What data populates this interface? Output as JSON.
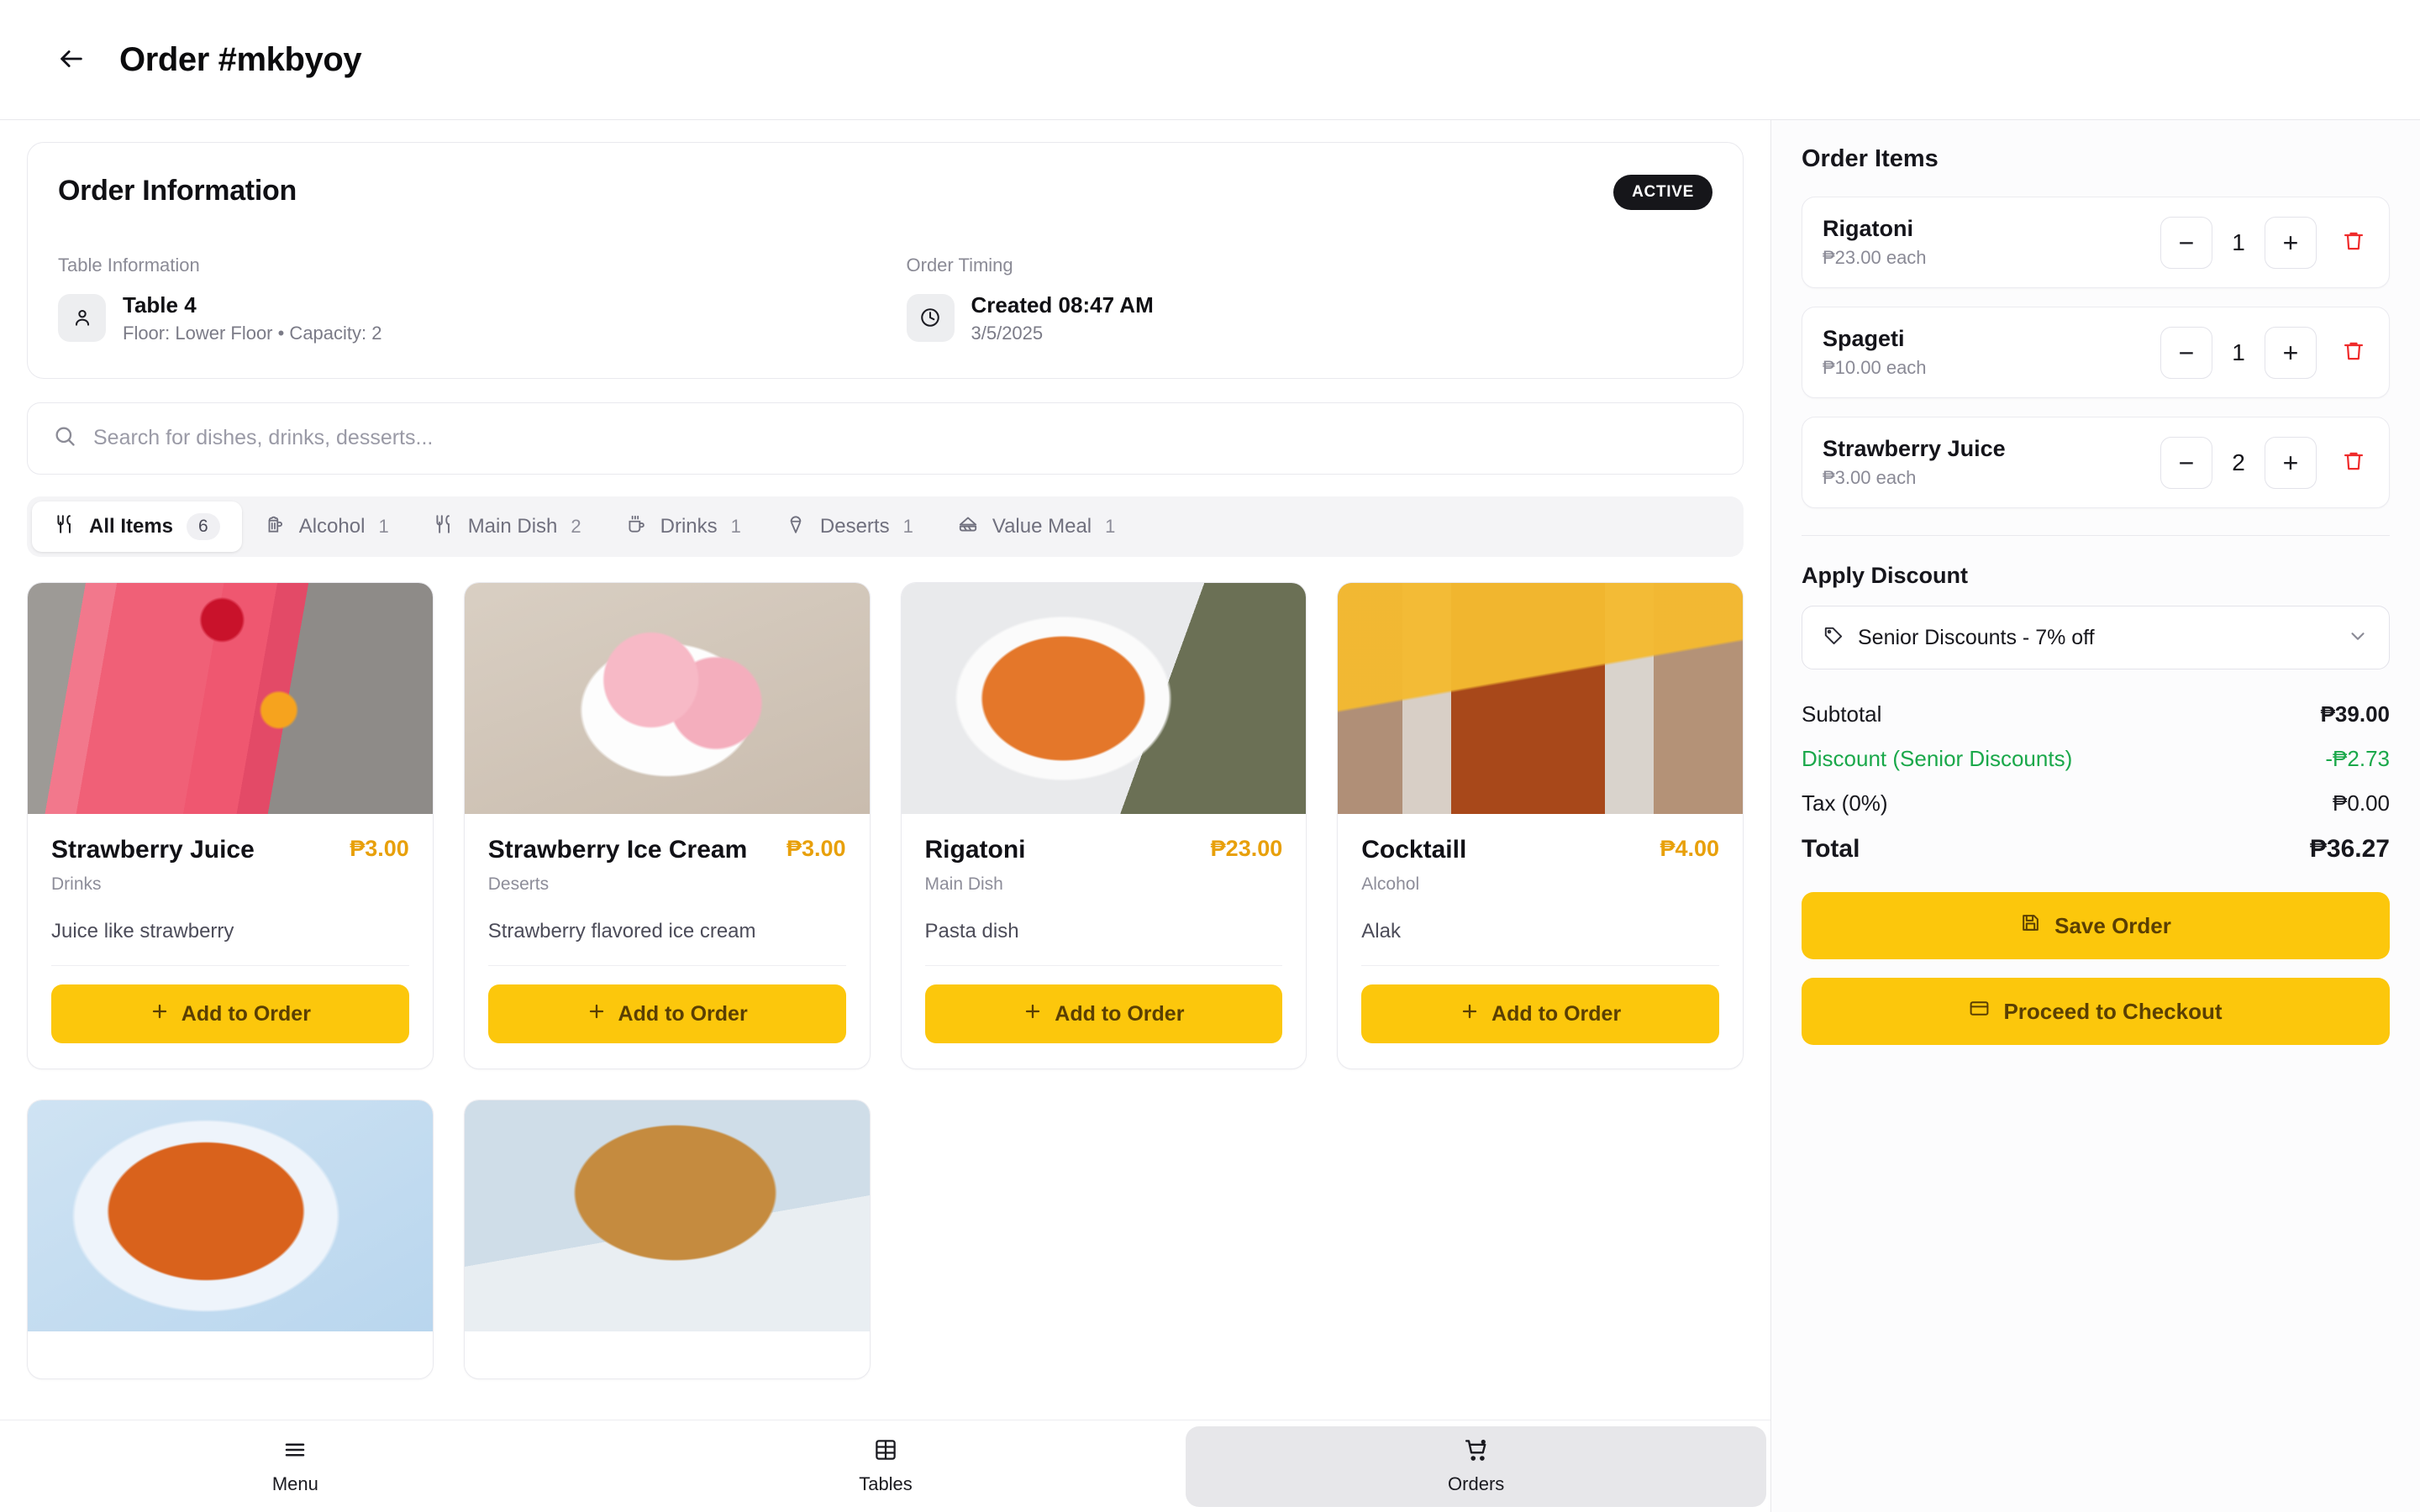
{
  "header": {
    "back_icon": "arrow-left-icon",
    "title": "Order #mkbyoy"
  },
  "order_info": {
    "title": "Order Information",
    "status_badge": "ACTIVE",
    "table_section_label": "Table Information",
    "table_icon": "user-icon",
    "table_name": "Table 4",
    "table_detail": "Floor: Lower Floor  •  Capacity: 2",
    "timing_section_label": "Order Timing",
    "timing_icon": "clock-icon",
    "created_time": "Created 08:47 AM",
    "created_date": "3/5/2025"
  },
  "search": {
    "icon": "search-icon",
    "placeholder": "Search for dishes, drinks, desserts...",
    "value": ""
  },
  "tabs": [
    {
      "label": "All Items",
      "count": "6",
      "icon": "fork-knife-icon",
      "active": true
    },
    {
      "label": "Alcohol",
      "count": "1",
      "icon": "beer-mug-icon",
      "active": false
    },
    {
      "label": "Main Dish",
      "count": "2",
      "icon": "fork-knife-icon",
      "active": false
    },
    {
      "label": "Drinks",
      "count": "1",
      "icon": "coffee-cup-icon",
      "active": false
    },
    {
      "label": "Deserts",
      "count": "1",
      "icon": "ice-cream-cone-icon",
      "active": false
    },
    {
      "label": "Value Meal",
      "count": "1",
      "icon": "sandwich-icon",
      "active": false
    }
  ],
  "menu": {
    "add_button_label": "Add to Order",
    "add_icon": "plus-icon",
    "items": [
      {
        "name": "Strawberry Juice",
        "price": "₱3.00",
        "category": "Drinks",
        "description": "Juice like strawberry",
        "image": "strawberry-juice-photo"
      },
      {
        "name": "Strawberry Ice Cream",
        "price": "₱3.00",
        "category": "Deserts",
        "description": "Strawberry flavored ice cream",
        "image": "strawberry-ice-cream-photo"
      },
      {
        "name": "Rigatoni",
        "price": "₱23.00",
        "category": "Main Dish",
        "description": "Pasta dish",
        "image": "rigatoni-photo"
      },
      {
        "name": "Cocktaill",
        "price": "₱4.00",
        "category": "Alcohol",
        "description": "Alak",
        "image": "cocktail-photo"
      }
    ],
    "partial_row_images": [
      "spaghetti-photo",
      "burger-photo"
    ]
  },
  "order_panel": {
    "title": "Order Items",
    "decrement_label": "−",
    "increment_label": "+",
    "delete_icon": "trash-icon",
    "items": [
      {
        "name": "Rigatoni",
        "unit_price": "₱23.00 each",
        "qty": "1"
      },
      {
        "name": "Spageti",
        "unit_price": "₱10.00 each",
        "qty": "1"
      },
      {
        "name": "Strawberry Juice",
        "unit_price": "₱3.00 each",
        "qty": "2"
      }
    ],
    "discount_label": "Apply Discount",
    "discount_icon": "tag-icon",
    "discount_selected": "Senior Discounts - 7% off",
    "discount_chevron": "chevron-down-icon",
    "totals": {
      "subtotal_label": "Subtotal",
      "subtotal_value": "₱39.00",
      "discount_label": "Discount (Senior Discounts)",
      "discount_value": "-₱2.73",
      "tax_label": "Tax (0%)",
      "tax_value": "₱0.00",
      "total_label": "Total",
      "total_value": "₱36.27"
    },
    "save_label": "Save Order",
    "save_icon": "save-disk-icon",
    "checkout_label": "Proceed to Checkout",
    "checkout_icon": "credit-card-icon"
  },
  "bottom_nav": [
    {
      "label": "Menu",
      "icon": "list-menu-icon",
      "active": false
    },
    {
      "label": "Tables",
      "icon": "grid-table-icon",
      "active": false
    },
    {
      "label": "Orders",
      "icon": "shopping-cart-icon",
      "active": true
    }
  ],
  "colors": {
    "accent_yellow": "#FCC70C",
    "price_orange": "#E8A00A",
    "discount_green": "#1AA84A",
    "delete_red": "#EF2B2B",
    "badge_dark": "#16161A"
  }
}
